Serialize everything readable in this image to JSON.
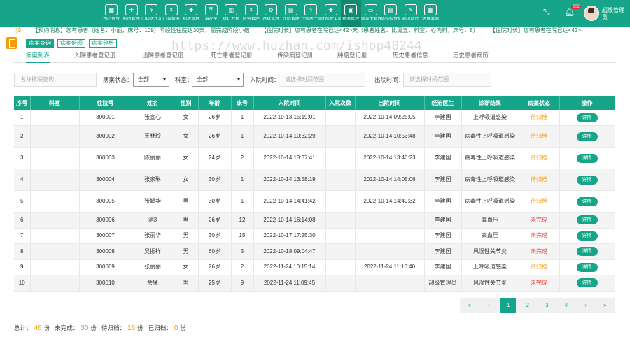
{
  "header": {
    "nav": [
      {
        "label": "预约挂号",
        "icon": "calendar-icon",
        "active": false
      },
      {
        "label": "药房管理",
        "icon": "pill-icon",
        "active": false
      },
      {
        "label": "门诊医生站",
        "icon": "stethoscope-icon",
        "active": false
      },
      {
        "label": "门诊费用",
        "icon": "money-icon",
        "active": false
      },
      {
        "label": "药房管理",
        "icon": "medicine-icon",
        "active": false
      },
      {
        "label": "治疗室",
        "icon": "treatment-icon",
        "active": false
      },
      {
        "label": "统计分析",
        "icon": "chart-icon",
        "active": false
      },
      {
        "label": "财务管理",
        "icon": "finance-icon",
        "active": false
      },
      {
        "label": "系统管理",
        "icon": "settings-icon",
        "active": false
      },
      {
        "label": "住院管理",
        "icon": "bed-icon",
        "active": false
      },
      {
        "label": "住院医生站",
        "icon": "doctor-icon",
        "active": false
      },
      {
        "label": "住院护士站",
        "icon": "nurse-icon",
        "active": false
      },
      {
        "label": "病案管理",
        "icon": "record-icon",
        "active": true
      },
      {
        "label": "就诊卡管理",
        "icon": "card-icon",
        "active": false
      },
      {
        "label": "体检检查管理",
        "icon": "exam-icon",
        "active": false
      },
      {
        "label": "病历质控",
        "icon": "quality-icon",
        "active": false
      },
      {
        "label": "医保业务",
        "icon": "insurance-icon",
        "active": false
      }
    ],
    "notification_count": "202",
    "user_name": "超级管理员"
  },
  "ticker": [
    "【预约消息】您有患者（姓名：小丽，床号：109）阶段性住院达30天，需完成阶段小结",
    "【住院时长】您有患者在院已达<42>天（患者姓名：比周五，科室：心内科，床号：8）",
    "【住院时长】您有患者在院已达<42>"
  ],
  "subnav": [
    "病案查询",
    "病案借阅",
    "病案分析"
  ],
  "tabs": [
    "病案列表",
    "入院患者登记册",
    "出院患者登记册",
    "死亡患者登记册",
    "传染病登记册",
    "肿瘤登记册",
    "历史患者信息",
    "历史患者病历"
  ],
  "filters": {
    "search_placeholder": "名称模糊查询",
    "status_label": "病案状态：",
    "status_value": "全部",
    "dept_label": "科室：",
    "dept_value": "全部",
    "admit_label": "入院时间：",
    "admit_placeholder": "请选择时间范围",
    "discharge_label": "出院时间：",
    "discharge_placeholder": "请选择时间范围"
  },
  "table": {
    "columns": [
      "序号",
      "科室",
      "住院号",
      "姓名",
      "性别",
      "年龄",
      "床号",
      "入院时间",
      "入院次数",
      "出院时间",
      "经治医生",
      "诊断结果",
      "病案状态",
      "操作"
    ],
    "rows": [
      [
        "1",
        "",
        "300001",
        "张宣心",
        "女",
        "26岁",
        "1",
        "2022-10-13 15:19:01",
        "",
        "2022-10-14 09:25:05",
        "李建国",
        "上呼吸道感染",
        "待归档",
        "详情"
      ],
      [
        "2",
        "",
        "300002",
        "王林玲",
        "女",
        "26岁",
        "1",
        "2022-10-14 10:32:29",
        "",
        "2022-10-14 10:53:48",
        "李建国",
        "病毒性上呼吸道感染",
        "待归档",
        "详情"
      ],
      [
        "3",
        "",
        "300003",
        "陈丽丽",
        "女",
        "24岁",
        "2",
        "2022-10-14 13:37:41",
        "",
        "2022-10-14 13:46:23",
        "李建国",
        "病毒性上呼吸道感染",
        "待归档",
        "详情"
      ],
      [
        "4",
        "",
        "300004",
        "张家琳",
        "女",
        "30岁",
        "1",
        "2022-10-14 13:58:19",
        "",
        "2022-10-14 14:05:06",
        "李建国",
        "病毒性上呼吸道感染",
        "待归档",
        "详情"
      ],
      [
        "5",
        "",
        "300005",
        "张娟华",
        "男",
        "30岁",
        "1",
        "2022-10-14 14:41:42",
        "",
        "2022-10-14 14:49:32",
        "李建国",
        "病毒性上呼吸道感染",
        "待归档",
        "详情"
      ],
      [
        "6",
        "",
        "300006",
        "测3",
        "男",
        "26岁",
        "12",
        "2022-10-14 16:14:08",
        "",
        "",
        "李建国",
        "高血压",
        "未完成",
        "详情"
      ],
      [
        "7",
        "",
        "300007",
        "张丽华",
        "男",
        "30岁",
        "15",
        "2022-10-17 17:25:30",
        "",
        "",
        "李建国",
        "高血压",
        "未完成",
        "详情"
      ],
      [
        "8",
        "",
        "300008",
        "吴振祥",
        "男",
        "60岁",
        "5",
        "2022-10-18 09:04:47",
        "",
        "",
        "李建国",
        "风湿性关节炎",
        "未完成",
        "详情"
      ],
      [
        "9",
        "",
        "300009",
        "张丽丽",
        "女",
        "26岁",
        "2",
        "2022-11-24 10:15:14",
        "",
        "2022-11-24 11:10:40",
        "李建国",
        "上呼吸道感染",
        "待归档",
        "详情"
      ],
      [
        "10",
        "",
        "300010",
        "余猛",
        "男",
        "25岁",
        "9",
        "2022-11-24 11:09:45",
        "",
        "",
        "超级管理员",
        "风湿性关节炎",
        "未完成",
        "详情"
      ]
    ]
  },
  "pager": [
    "«",
    "‹",
    "1",
    "2",
    "3",
    "4",
    "›",
    "»"
  ],
  "summary": {
    "total_label": "总计：",
    "total": "46",
    "total_unit": "份",
    "unfinished_label": "未完成：",
    "unfinished": "30",
    "unfinished_unit": "份",
    "pending_label": "待归档：",
    "pending": "16",
    "pending_unit": "份",
    "archived_label": "已归档：",
    "archived": "0",
    "archived_unit": "份"
  },
  "watermark": "https://www.huzhan.com/ishop48244",
  "colors": {
    "primary": "#17a589",
    "pending": "#f39c12",
    "unfinished": "#e74c3c"
  }
}
